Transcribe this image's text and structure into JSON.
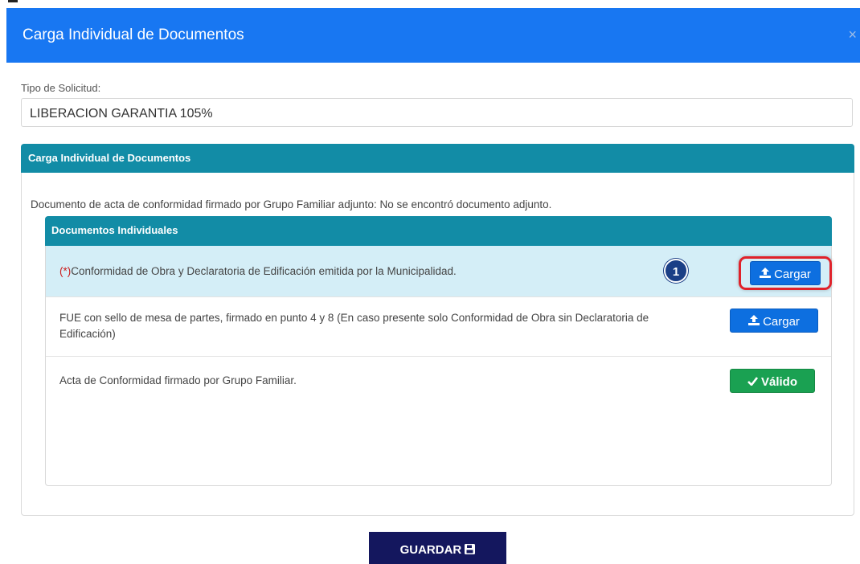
{
  "modal": {
    "title": "Carga Individual de Documentos",
    "close_icon": "×"
  },
  "form": {
    "label": "Tipo de Solicitud:",
    "value": "LIBERACION GARANTIA 105%"
  },
  "panel": {
    "title": "Carga Individual de Documentos",
    "note": "Documento de acta de conformidad firmado por Grupo Familiar adjunto: No se encontró documento adjunto."
  },
  "documents": {
    "title": "Documentos Individuales",
    "rows": [
      {
        "required_mark": "(*)",
        "text": "Conformidad de Obra y Declaratoria de Edificación emitida por la Municipalidad.",
        "button_icon": "upload-icon",
        "button_label": "Cargar",
        "step_badge": "1"
      },
      {
        "text": "FUE con sello de mesa de partes, firmado en punto 4 y 8 (En caso presente solo Conformidad de Obra sin Declaratoria de Edificación)",
        "button_icon": "upload-icon",
        "button_label": "Cargar"
      },
      {
        "text": "Acta de Conformidad firmado por Grupo Familiar.",
        "button_icon": "check-icon",
        "button_label": "Válido"
      }
    ]
  },
  "footer": {
    "save_label": "GUARDAR",
    "save_icon": "floppy-disk-icon"
  },
  "colors": {
    "header_blue": "#1877f2",
    "panel_teal": "#128ca6",
    "button_blue": "#0d6fe0",
    "valid_green": "#1aa152",
    "save_navy": "#14175e",
    "highlight_red": "#e0222a"
  }
}
